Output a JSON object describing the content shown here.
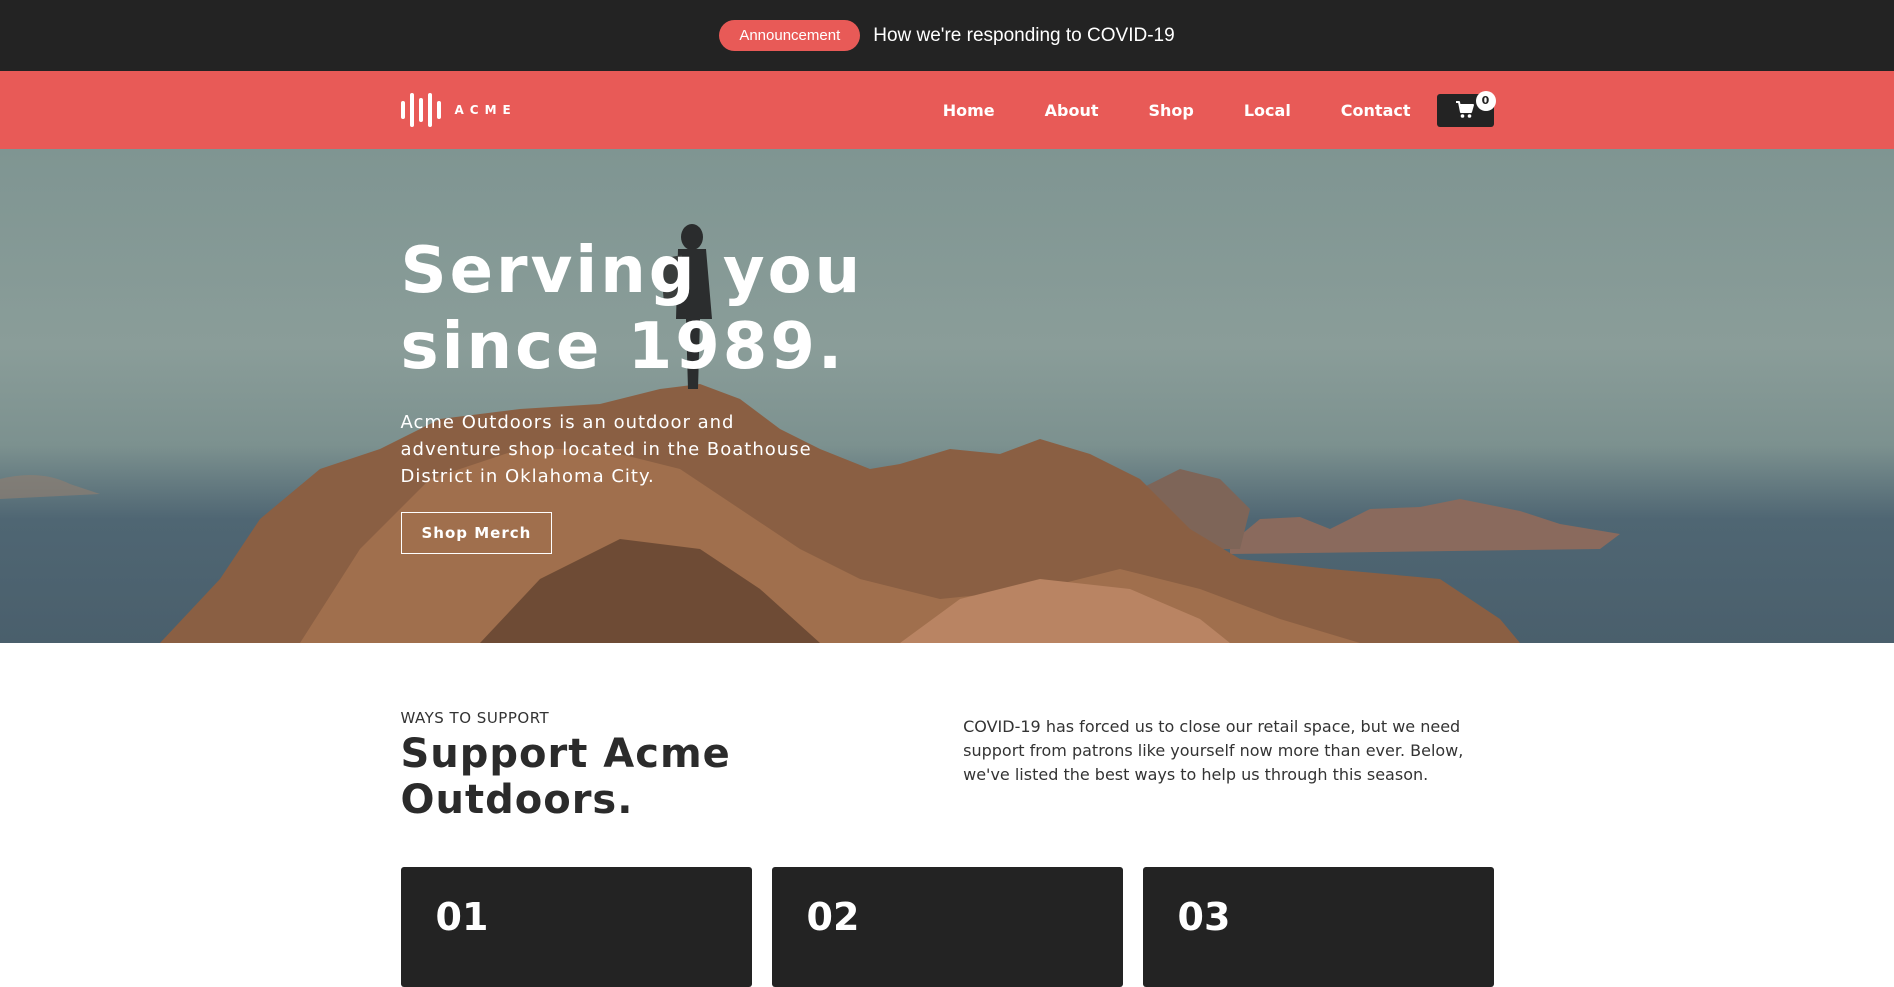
{
  "announcement": {
    "badge": "Announcement",
    "text": "How we're responding to COVID-19"
  },
  "header": {
    "logo_text": "ACME",
    "nav": [
      "Home",
      "About",
      "Shop",
      "Local",
      "Contact"
    ],
    "cart_count": "0"
  },
  "hero": {
    "title_line1": "Serving you",
    "title_line2": "since 1989.",
    "description": "Acme Outdoors is an outdoor and adventure shop located in the Boathouse District in Oklahoma City.",
    "button": "Shop Merch"
  },
  "support": {
    "eyebrow": "WAYS TO SUPPORT",
    "title": "Support Acme Outdoors.",
    "text": "COVID-19 has forced us to close our retail space, but we need support from patrons like yourself now more than ever. Below, we've listed the best ways to help us through this season.",
    "cards": [
      "01",
      "02",
      "03"
    ]
  },
  "colors": {
    "accent": "#e85a57",
    "dark": "#232323"
  }
}
